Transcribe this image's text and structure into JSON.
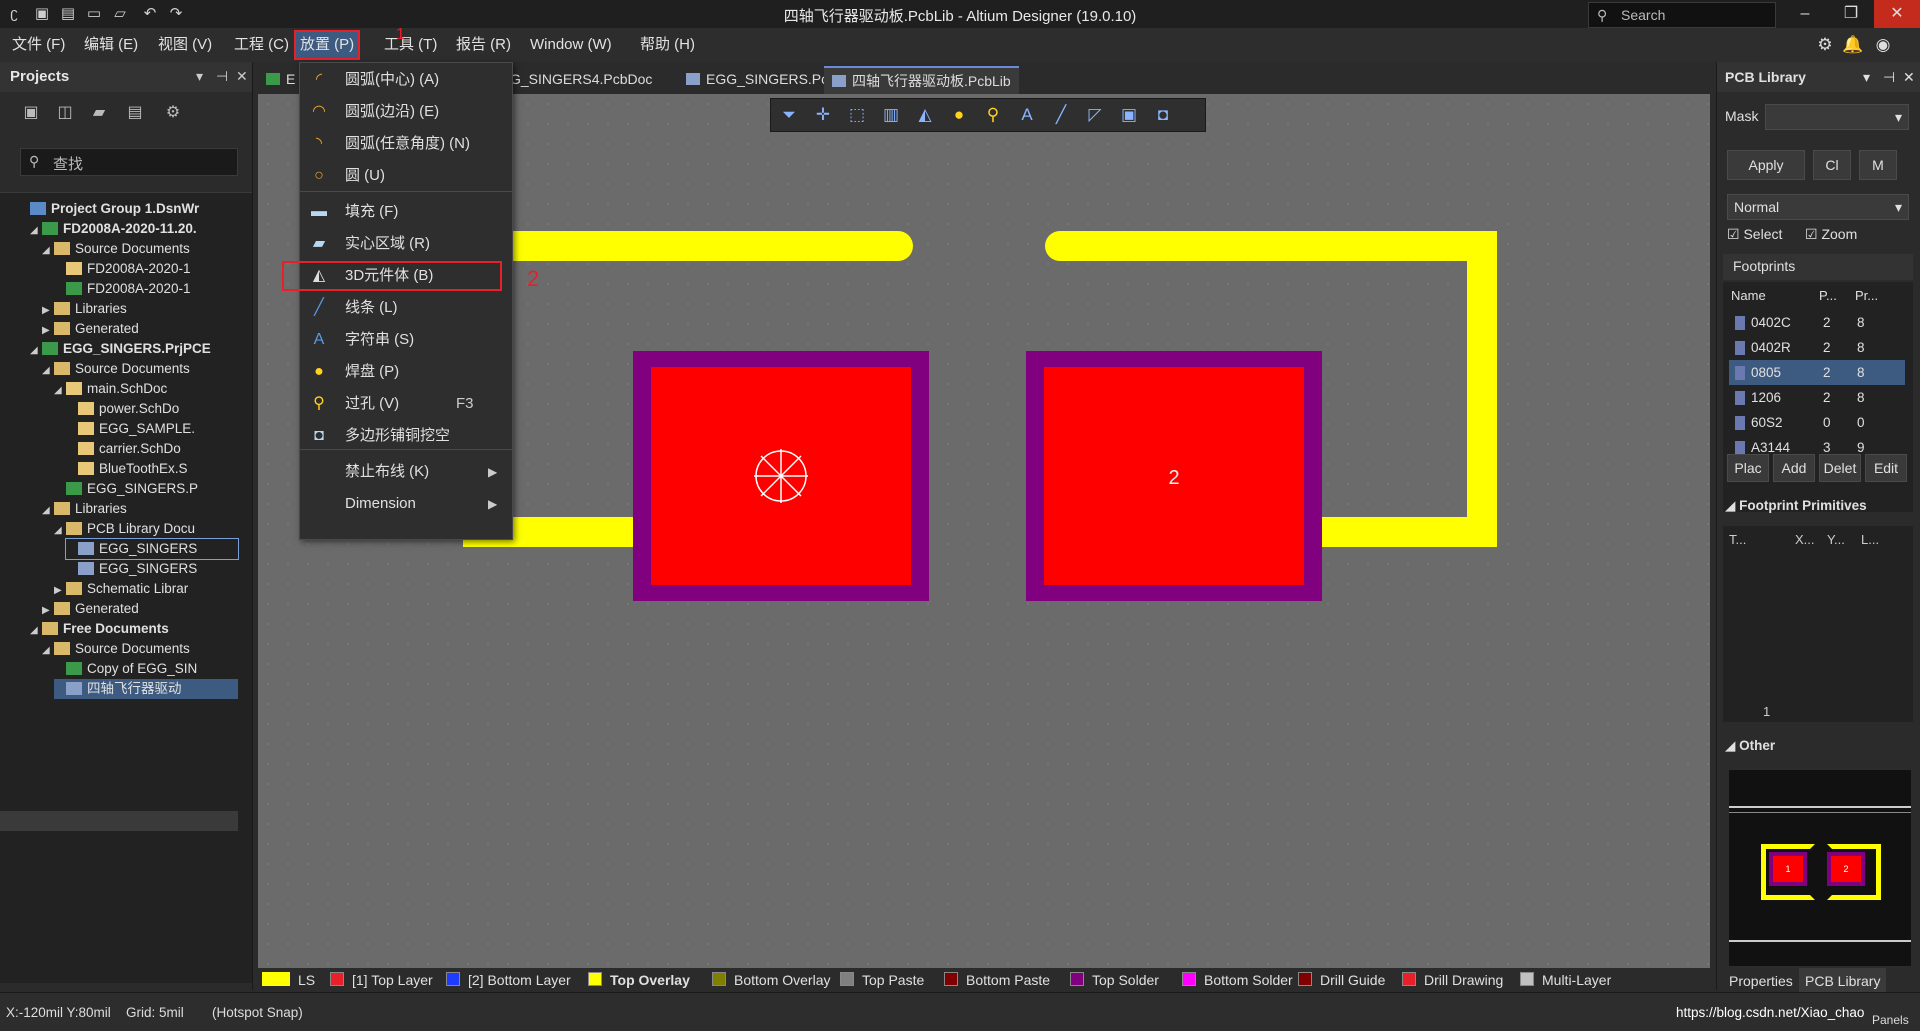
{
  "window": {
    "title": "四轴飞行器驱动板.PcbLib - Altium Designer (19.0.10)",
    "search_placeholder": "Search"
  },
  "menubar": {
    "items": [
      "文件 (F)",
      "编辑 (E)",
      "视图 (V)",
      "工程 (C)",
      "放置 (P)",
      "工具 (T)",
      "报告 (R)",
      "Window (W)",
      "帮助 (H)"
    ]
  },
  "place_menu": {
    "items": [
      {
        "label": "圆弧(中心) (A)",
        "icon": "arc-center-icon"
      },
      {
        "label": "圆弧(边沿) (E)",
        "icon": "arc-edge-icon"
      },
      {
        "label": "圆弧(任意角度) (N)",
        "icon": "arc-any-icon"
      },
      {
        "label": "圆 (U)",
        "icon": "circle-icon"
      },
      {
        "label": "填充 (F)",
        "icon": "fill-icon"
      },
      {
        "label": "实心区域 (R)",
        "icon": "solid-region-icon"
      },
      {
        "label": "3D元件体 (B)",
        "icon": "3d-body-icon"
      },
      {
        "label": "线条 (L)",
        "icon": "line-icon"
      },
      {
        "label": "字符串 (S)",
        "icon": "string-icon"
      },
      {
        "label": "焊盘 (P)",
        "icon": "pad-icon"
      },
      {
        "label": "过孔 (V)",
        "shortcut": "F3",
        "icon": "via-icon"
      },
      {
        "label": "多边形铺铜挖空",
        "icon": "polygon-cutout-icon"
      },
      {
        "label": "禁止布线 (K)",
        "submenu": true
      },
      {
        "label": "Dimension",
        "submenu": true
      }
    ],
    "annotation_1": "1",
    "annotation_2": "2"
  },
  "projects": {
    "title": "Projects",
    "search_placeholder": "查找",
    "tree": [
      {
        "label": "Project Group 1.DsnWr",
        "depth": 0,
        "arrow": "",
        "icon": "grp",
        "bold": true
      },
      {
        "label": "FD2008A-2020-11.20.",
        "depth": 1,
        "arrow": "◢",
        "icon": "pcb",
        "bold": true
      },
      {
        "label": "Source Documents",
        "depth": 2,
        "arrow": "◢",
        "icon": "fold"
      },
      {
        "label": "FD2008A-2020-1",
        "depth": 3,
        "arrow": "",
        "icon": "sch"
      },
      {
        "label": "FD2008A-2020-1",
        "depth": 3,
        "arrow": "",
        "icon": "pcb"
      },
      {
        "label": "Libraries",
        "depth": 2,
        "arrow": "▶",
        "icon": "fold"
      },
      {
        "label": "Generated",
        "depth": 2,
        "arrow": "▶",
        "icon": "fold"
      },
      {
        "label": "EGG_SINGERS.PrjPCE",
        "depth": 1,
        "arrow": "◢",
        "icon": "pcb",
        "bold": true
      },
      {
        "label": "Source Documents",
        "depth": 2,
        "arrow": "◢",
        "icon": "fold"
      },
      {
        "label": "main.SchDoc",
        "depth": 3,
        "arrow": "◢",
        "icon": "sch"
      },
      {
        "label": "power.SchDo",
        "depth": 4,
        "arrow": "",
        "icon": "sch"
      },
      {
        "label": "EGG_SAMPLE.",
        "depth": 4,
        "arrow": "",
        "icon": "sch"
      },
      {
        "label": "carrier.SchDo",
        "depth": 4,
        "arrow": "",
        "icon": "sch"
      },
      {
        "label": "BlueToothEx.S",
        "depth": 4,
        "arrow": "",
        "icon": "sch"
      },
      {
        "label": "EGG_SINGERS.P",
        "depth": 3,
        "arrow": "",
        "icon": "pcb"
      },
      {
        "label": "Libraries",
        "depth": 2,
        "arrow": "◢",
        "icon": "fold"
      },
      {
        "label": "PCB Library Docu",
        "depth": 3,
        "arrow": "◢",
        "icon": "fold"
      },
      {
        "label": "EGG_SINGERS",
        "depth": 4,
        "arrow": "",
        "icon": "lib",
        "outline": true
      },
      {
        "label": "EGG_SINGERS",
        "depth": 4,
        "arrow": "",
        "icon": "lib"
      },
      {
        "label": "Schematic Librar",
        "depth": 3,
        "arrow": "▶",
        "icon": "fold"
      },
      {
        "label": "Generated",
        "depth": 2,
        "arrow": "▶",
        "icon": "fold"
      },
      {
        "label": "Free Documents",
        "depth": 1,
        "arrow": "◢",
        "icon": "fold",
        "bold": true
      },
      {
        "label": "Source Documents",
        "depth": 2,
        "arrow": "◢",
        "icon": "fold"
      },
      {
        "label": "Copy of EGG_SIN",
        "depth": 3,
        "arrow": "",
        "icon": "pcb"
      },
      {
        "label": "四轴飞行器驱动",
        "depth": 3,
        "arrow": "",
        "icon": "lib",
        "selected": true
      }
    ]
  },
  "doc_tabs": [
    {
      "label": "E",
      "icon": "pcb",
      "active": false
    },
    {
      "label": "f EGG_SINGERS4.PcbDoc",
      "icon": "",
      "active": false
    },
    {
      "label": "EGG_SINGERS.PcbLib",
      "icon": "lib",
      "active": false
    },
    {
      "label": "四轴飞行器驱动板.PcbLib",
      "icon": "lib",
      "active": true
    }
  ],
  "canvas": {
    "pad2_label": "2"
  },
  "pcb_library": {
    "title": "PCB Library",
    "mask_label": "Mask",
    "apply": "Apply",
    "clear": "Cl",
    "magnify": "M",
    "mode": "Normal",
    "select": "Select",
    "zoom": "Zoom",
    "footprints_header": "Footprints",
    "columns": [
      "Name",
      "P...",
      "Pr..."
    ],
    "footprints": [
      {
        "name": "0402C",
        "pads": "2",
        "prims": "8"
      },
      {
        "name": "0402R",
        "pads": "2",
        "prims": "8"
      },
      {
        "name": "0805",
        "pads": "2",
        "prims": "8",
        "selected": true
      },
      {
        "name": "1206",
        "pads": "2",
        "prims": "8"
      },
      {
        "name": "60S2",
        "pads": "0",
        "prims": "0"
      },
      {
        "name": "A3144",
        "pads": "3",
        "prims": "9"
      }
    ],
    "actions": [
      "Plac",
      "Add",
      "Delet",
      "Edit"
    ],
    "primitives_header": "Footprint Primitives",
    "primitive_columns": [
      "T...",
      "X...",
      "Y...",
      "L..."
    ],
    "primitive_row_value": "1",
    "other_header": "Other",
    "preview_pad1": "1",
    "preview_pad2": "2"
  },
  "layers": [
    {
      "label": "LS",
      "color": "#ffff00",
      "wide": true
    },
    {
      "label": "[1] Top Layer",
      "color": "#e8202a"
    },
    {
      "label": "[2] Bottom Layer",
      "color": "#1e3cff"
    },
    {
      "label": "Top Overlay",
      "color": "#ffff00",
      "active": true
    },
    {
      "label": "Bottom Overlay",
      "color": "#808000"
    },
    {
      "label": "Top Paste",
      "color": "#808080"
    },
    {
      "label": "Bottom Paste",
      "color": "#800000"
    },
    {
      "label": "Top Solder",
      "color": "#800080"
    },
    {
      "label": "Bottom Solder",
      "color": "#ff00ff"
    },
    {
      "label": "Drill Guide",
      "color": "#800000"
    },
    {
      "label": "Drill Drawing",
      "color": "#e8202a"
    },
    {
      "label": "Multi-Layer",
      "color": "#c0c0c0"
    }
  ],
  "status": {
    "coords": "X:-120mil Y:80mil",
    "grid": "Grid: 5mil",
    "snap": "(Hotspot Snap)",
    "watermark": "https://blog.csdn.net/Xiao_chao",
    "panels": "Panels"
  },
  "bottom_tabs": [
    "Properties",
    "PCB Library"
  ]
}
